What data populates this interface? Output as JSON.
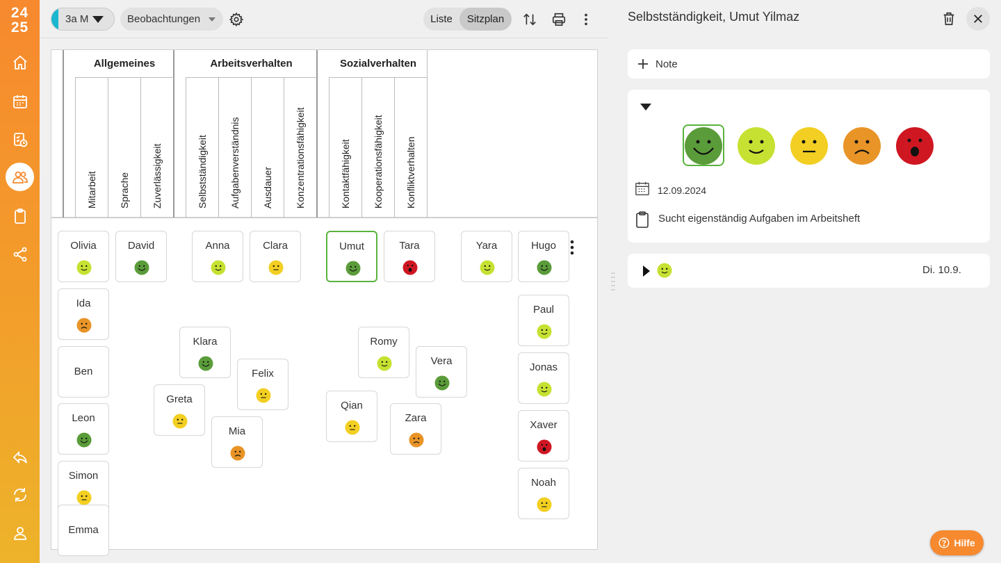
{
  "sidebar": {
    "year_top": "24",
    "year_bottom": "25",
    "items": [
      "home-icon",
      "calendar-icon",
      "task-clock-icon",
      "students-icon",
      "clipboard-icon",
      "share-icon",
      "back-icon",
      "sync-icon",
      "user-icon"
    ]
  },
  "topbar": {
    "class_label": "3a M",
    "class_color": "#1bb6d0",
    "view_select": "Beobachtungen",
    "toggle_list": "Liste",
    "toggle_seatplan": "Sitzplan",
    "active_view": "Sitzplan"
  },
  "header": {
    "groups": [
      {
        "title": "Allgemeines",
        "columns": [
          "Mitarbeit",
          "Sprache",
          "Zuverlässigkeit"
        ]
      },
      {
        "title": "Arbeitsverhalten",
        "columns": [
          "Selbstständigkeit",
          "Aufgabenverständnis",
          "Ausdauer",
          "Konzentrationsfähigkeit"
        ]
      },
      {
        "title": "Sozialverhalten",
        "columns": [
          "Kontaktfähigkeit",
          "Kooperationsfähigkeit",
          "Konfliktverhalten"
        ]
      }
    ]
  },
  "ratings": {
    "very_good": "#5b9c3a",
    "good": "#c7e132",
    "neutral": "#f2cf22",
    "bad": "#e89427",
    "very_bad": "#cf1722"
  },
  "students": [
    {
      "name": "Olivia",
      "rating": "good"
    },
    {
      "name": "David",
      "rating": "very_good"
    },
    {
      "name": "Anna",
      "rating": "good"
    },
    {
      "name": "Clara",
      "rating": "neutral"
    },
    {
      "name": "Umut",
      "rating": "very_good",
      "selected": true
    },
    {
      "name": "Tara",
      "rating": "very_bad"
    },
    {
      "name": "Yara",
      "rating": "good"
    },
    {
      "name": "Hugo",
      "rating": "very_good"
    },
    {
      "name": "Ida",
      "rating": "bad"
    },
    {
      "name": "Paul",
      "rating": "good"
    },
    {
      "name": "Ben",
      "rating": null
    },
    {
      "name": "Klara",
      "rating": "very_good"
    },
    {
      "name": "Romy",
      "rating": "good"
    },
    {
      "name": "Vera",
      "rating": "very_good"
    },
    {
      "name": "Jonas",
      "rating": "good"
    },
    {
      "name": "Felix",
      "rating": "neutral"
    },
    {
      "name": "Greta",
      "rating": "neutral"
    },
    {
      "name": "Qian",
      "rating": "neutral"
    },
    {
      "name": "Zara",
      "rating": "bad"
    },
    {
      "name": "Leon",
      "rating": "very_good"
    },
    {
      "name": "Xaver",
      "rating": "very_bad"
    },
    {
      "name": "Mia",
      "rating": "bad"
    },
    {
      "name": "Simon",
      "rating": "neutral"
    },
    {
      "name": "Noah",
      "rating": "neutral"
    },
    {
      "name": "Emma",
      "rating": null
    }
  ],
  "detail_panel": {
    "title": "Selbstständigkeit, Umut Yilmaz",
    "add_note": "Note",
    "selected_rating": "very_good",
    "date": "12.09.2024",
    "note_text": "Sucht eigenständig Aufgaben im Arbeitsheft",
    "history_entry": {
      "rating": "good",
      "date": "Di. 10.9."
    }
  },
  "help_button": "Hilfe"
}
